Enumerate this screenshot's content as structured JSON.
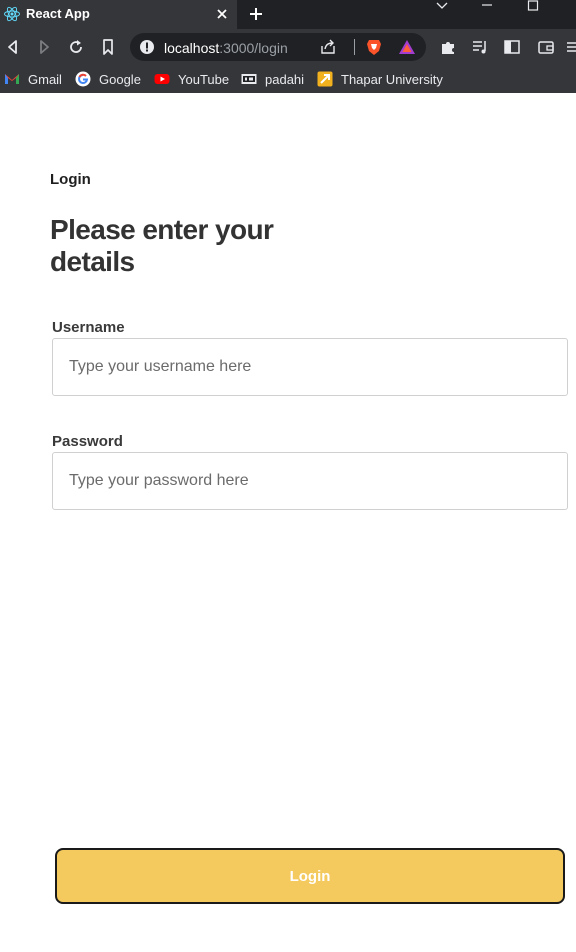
{
  "browser": {
    "tab": {
      "title": "React App",
      "favicon": "react-icon"
    },
    "address": {
      "host": "localhost",
      "rest": ":3000/login"
    },
    "bookmarks": [
      {
        "label": "Gmail",
        "icon": "gmail-icon"
      },
      {
        "label": "Google",
        "icon": "google-icon"
      },
      {
        "label": "YouTube",
        "icon": "youtube-icon"
      },
      {
        "label": "padahi",
        "icon": "padahi-icon"
      },
      {
        "label": "Thapar University",
        "icon": "thapar-icon"
      }
    ],
    "colors": {
      "tab_bar": "#202124",
      "toolbar": "#35363a"
    }
  },
  "page": {
    "breadcrumb": "Login",
    "heading": "Please enter your details",
    "username": {
      "label": "Username",
      "placeholder": "Type your username here",
      "value": ""
    },
    "password": {
      "label": "Password",
      "placeholder": "Type your password here",
      "value": ""
    },
    "submit_label": "Login",
    "colors": {
      "button": "#f4c95d",
      "button_border": "#1a1a1a",
      "heading": "#333333"
    }
  }
}
